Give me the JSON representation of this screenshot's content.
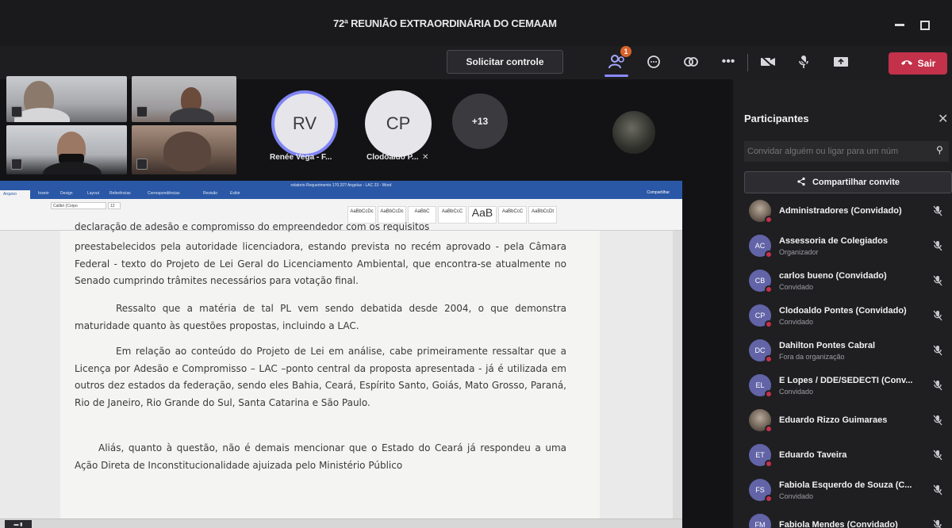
{
  "window": {
    "title": "72ª REUNIÃO EXTRAORDINÁRIA DO CEMAAM"
  },
  "toolbar": {
    "request_control_label": "Solicitar controle",
    "participants_badge": "1",
    "leave_label": "Sair",
    "icons": [
      "people-icon",
      "chat-icon",
      "reactions-icon",
      "more-icon",
      "camera-icon",
      "mic-icon",
      "share-icon",
      "phone-icon"
    ]
  },
  "stage": {
    "avatars": [
      {
        "initials": "RV",
        "name": "Renée Vega - F..."
      },
      {
        "initials": "CP",
        "name": "Clodoaldo P..."
      }
    ],
    "overflow_count": "+13"
  },
  "word": {
    "title": "relatorio Requerimento 170.20? Angelus - LAC 23 - Word",
    "active_tab": "Arquivo",
    "tabs": [
      "Inserir",
      "Design",
      "Layout",
      "Referências",
      "Correspondências",
      "Revisão",
      "Exibir"
    ],
    "share_label": "Compartilhar",
    "font_name": "Calibri (Corpo",
    "font_size": "12",
    "styles": [
      "AaBbCcDc",
      "AaBbCcDc",
      "AaBbC",
      "AaBbCcC",
      "AaB",
      "AaBbCcC",
      "AaBbCcDt"
    ],
    "cut_line": "declaração de adesão e compromisso do empreendedor com os requisitos",
    "paragraphs": [
      "preestabelecidos pela autoridade licenciadora, estando prevista no recém aprovado - pela Câmara Federal - texto do Projeto de Lei Geral do Licenciamento Ambiental, que encontra-se atualmente no Senado cumprindo trâmites necessários para votação final.",
      "Ressalto que a matéria de tal PL vem sendo debatida desde 2004, o que demonstra maturidade quanto às questões propostas, incluindo a LAC.",
      "Em relação ao conteúdo do Projeto de Lei em análise, cabe primeiramente ressaltar que a Licença por Adesão e Compromisso – LAC –ponto central da proposta apresentada - já é utilizada em outros dez estados da federação, sendo eles Bahia, Ceará, Espírito Santo, Goiás, Mato Grosso, Paraná, Rio de Janeiro, Rio Grande do Sul, Santa Catarina e São Paulo.",
      "Aliás, quanto à questão, não é demais mencionar que o Estado do Ceará já respondeu a uma Ação Direta de Inconstitucionalidade ajuizada pelo Ministério Público"
    ]
  },
  "panel": {
    "title": "Participantes",
    "invite_placeholder": "Convidar alguém ou ligar para um núm",
    "share_invite_label": "Compartilhar convite",
    "participants": [
      {
        "initials": "",
        "name": "Administradores (Convidado)",
        "role": "",
        "photo": true
      },
      {
        "initials": "AC",
        "name": "Assessoria de Colegiados",
        "role": "Organizador",
        "photo": false
      },
      {
        "initials": "CB",
        "name": "carlos bueno (Convidado)",
        "role": "Convidado",
        "photo": false
      },
      {
        "initials": "CP",
        "name": "Clodoaldo Pontes (Convidado)",
        "role": "Convidado",
        "photo": false
      },
      {
        "initials": "DC",
        "name": "Dahilton Pontes Cabral",
        "role": "Fora da organização",
        "photo": false
      },
      {
        "initials": "EL",
        "name": "E Lopes / DDE/SEDECTI (Conv...",
        "role": "Convidado",
        "photo": false
      },
      {
        "initials": "",
        "name": "Eduardo Rizzo Guimaraes",
        "role": "",
        "photo": true
      },
      {
        "initials": "ET",
        "name": "Eduardo Taveira",
        "role": "",
        "photo": false
      },
      {
        "initials": "FS",
        "name": "Fabiola Esquerdo de Souza (C...",
        "role": "Convidado",
        "photo": false
      },
      {
        "initials": "FM",
        "name": "Fabiola Mendes (Convidado)",
        "role": "",
        "photo": false
      }
    ]
  },
  "colors": {
    "accent": "#6264a7",
    "leave": "#c4314b",
    "word_blue": "#2b58a6"
  }
}
